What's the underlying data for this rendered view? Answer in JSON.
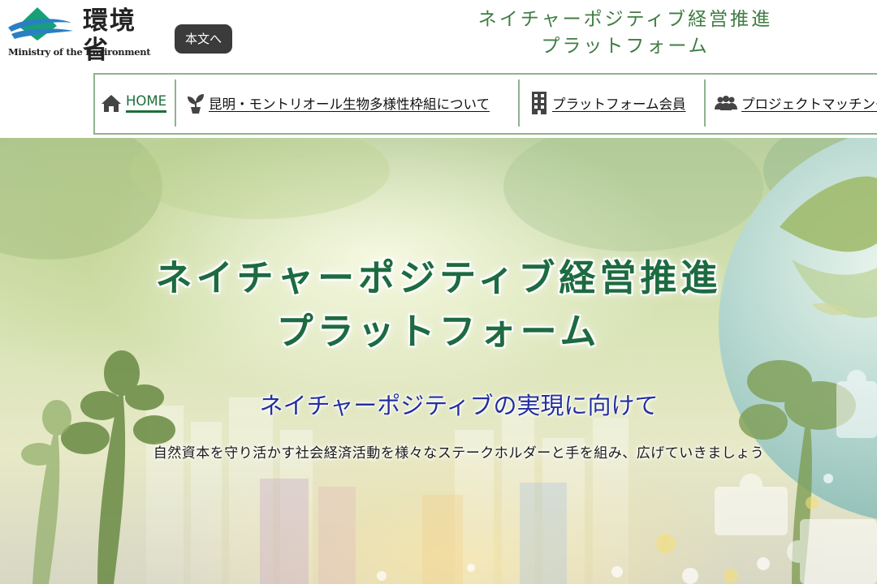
{
  "header": {
    "logo": {
      "jp": "環境省",
      "en": "Ministry of the Environment"
    },
    "skip_link": "本文へ",
    "site_title": {
      "line1": "ネイチャーポジティブ経営推進",
      "line2": "プラットフォーム"
    }
  },
  "nav": {
    "items": [
      {
        "label": "HOME",
        "icon": "home-icon"
      },
      {
        "label": "昆明・モントリオール生物多様性枠組について",
        "icon": "sprout-icon"
      },
      {
        "label": "プラットフォーム会員",
        "icon": "building-icon"
      },
      {
        "label": "プロジェクトマッチング",
        "icon": "people-icon"
      }
    ]
  },
  "hero": {
    "title_line1": "ネイチャーポジティブ経営推進",
    "title_line2": "プラットフォーム",
    "subtitle": "ネイチャーポジティブの実現に向けて",
    "description": "自然資本を守り活かす社会経済活動を様々なステークホルダーと手を組み、広げていきましょう"
  },
  "colors": {
    "brand_green": "#1d6b40",
    "nav_border": "#8fb38f",
    "subtitle_blue": "#24309a",
    "skip_button_bg": "#3b3b3b"
  }
}
